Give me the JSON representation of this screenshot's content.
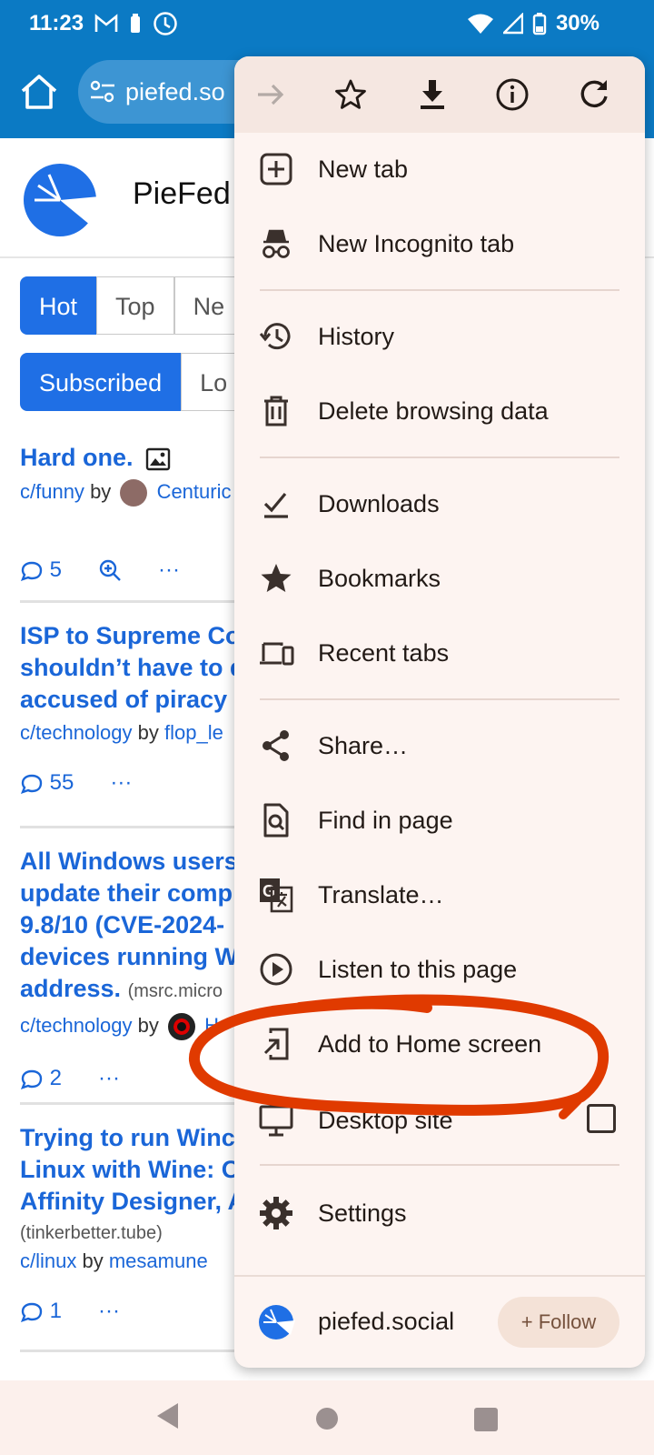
{
  "status_bar": {
    "time": "11:23",
    "battery": "30%",
    "icons": [
      "gmail-icon",
      "battery-saver-icon",
      "clock-icon",
      "wifi-icon",
      "signal-icon"
    ]
  },
  "browser": {
    "url": "piefed.social",
    "url_visible": "piefed.so"
  },
  "page": {
    "site_name": "PieFed",
    "sort_tabs": [
      "Hot",
      "Top",
      "Ne"
    ],
    "filter_tabs": [
      "Subscribed",
      "Lo"
    ],
    "posts": [
      {
        "title_lines": [
          "Hard one."
        ],
        "domain": "",
        "community": "c/funny",
        "by": "by",
        "user": "Centuric",
        "comments": "5"
      },
      {
        "title_lines": [
          "ISP to Supreme Co",
          "shouldn’t have to d",
          "accused of piracy"
        ],
        "domain": "",
        "community": "c/technology",
        "by": "by",
        "user": "flop_le",
        "comments": "55"
      },
      {
        "title_lines": [
          "All Windows users",
          "update their comp",
          "9.8/10 (CVE-2024-",
          "devices running W",
          "address."
        ],
        "domain": "(msrc.micro",
        "community": "c/technology",
        "by": "by",
        "user": "H",
        "comments": "2"
      },
      {
        "title_lines": [
          "Trying to run Winc",
          "Linux with Wine: O",
          "Affinity Designer, A"
        ],
        "domain": "(tinkerbetter.tube)",
        "community": "c/linux",
        "by": "by",
        "user": "mesamune",
        "comments": "1"
      }
    ],
    "more_symbol": "···"
  },
  "menu": {
    "toolbar": [
      "forward-icon",
      "bookmark-star-icon",
      "download-icon",
      "info-icon",
      "refresh-icon"
    ],
    "items": [
      {
        "label": "New tab",
        "icon": "new-tab-icon"
      },
      {
        "label": "New Incognito tab",
        "icon": "incognito-icon"
      },
      {
        "label": "History",
        "icon": "history-icon"
      },
      {
        "label": "Delete browsing data",
        "icon": "trash-icon"
      },
      {
        "label": "Downloads",
        "icon": "downloads-icon"
      },
      {
        "label": "Bookmarks",
        "icon": "bookmarks-icon"
      },
      {
        "label": "Recent tabs",
        "icon": "devices-icon"
      },
      {
        "label": "Share…",
        "icon": "share-icon"
      },
      {
        "label": "Find in page",
        "icon": "find-in-page-icon"
      },
      {
        "label": "Translate…",
        "icon": "translate-icon"
      },
      {
        "label": "Listen to this page",
        "icon": "play-circle-icon"
      },
      {
        "label": "Add to Home screen",
        "icon": "add-to-home-icon"
      },
      {
        "label": "Desktop site",
        "icon": "desktop-icon",
        "checked": false
      },
      {
        "label": "Settings",
        "icon": "settings-icon"
      }
    ],
    "footer": {
      "site": "piefed.social",
      "follow_label": "Follow",
      "follow_prefix": "+"
    }
  },
  "colors": {
    "browser_bar": "#0b7ac4",
    "link": "#1a66d8",
    "accent": "#1f6fe5",
    "menu_bg": "#fdf4f1",
    "annotation": "#e03a00"
  }
}
